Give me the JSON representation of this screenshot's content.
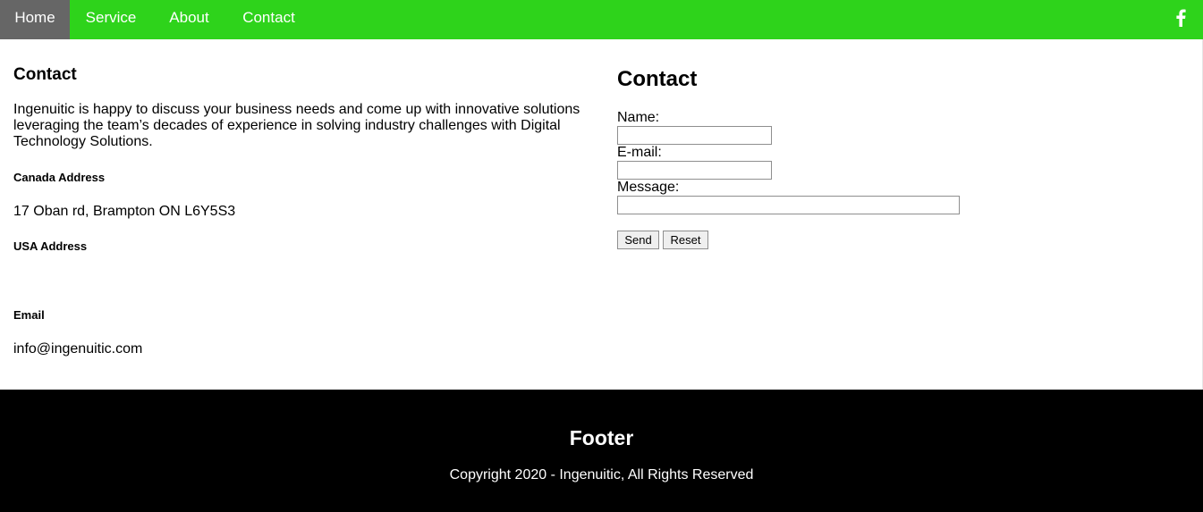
{
  "nav": {
    "items": [
      {
        "label": "Home",
        "active": true
      },
      {
        "label": "Service"
      },
      {
        "label": "About"
      },
      {
        "label": "Contact"
      }
    ],
    "social_icon": "facebook-icon",
    "bar_color": "#2ed31b",
    "active_color": "#666666"
  },
  "info": {
    "title": "Contact",
    "intro": "Ingenuitic is happy to discuss your business needs and come up with innovative solutions leveraging the team’s decades of experience in solving industry challenges with Digital Technology Solutions.",
    "canada_heading": "Canada Address",
    "canada_address": "17 Oban rd, Brampton ON L6Y5S3",
    "usa_heading": "USA Address",
    "usa_address": "",
    "email_heading": "Email",
    "email": "info@ingenuitic.com"
  },
  "form": {
    "title": "Contact",
    "name_label": "Name:",
    "name_value": "",
    "email_label": "E-mail:",
    "email_value": "",
    "message_label": "Message:",
    "message_value": "",
    "send_label": "Send",
    "reset_label": "Reset"
  },
  "footer": {
    "title": "Footer",
    "copyright": "Copyright 2020 - Ingenuitic, All Rights Reserved",
    "background": "#000000"
  }
}
